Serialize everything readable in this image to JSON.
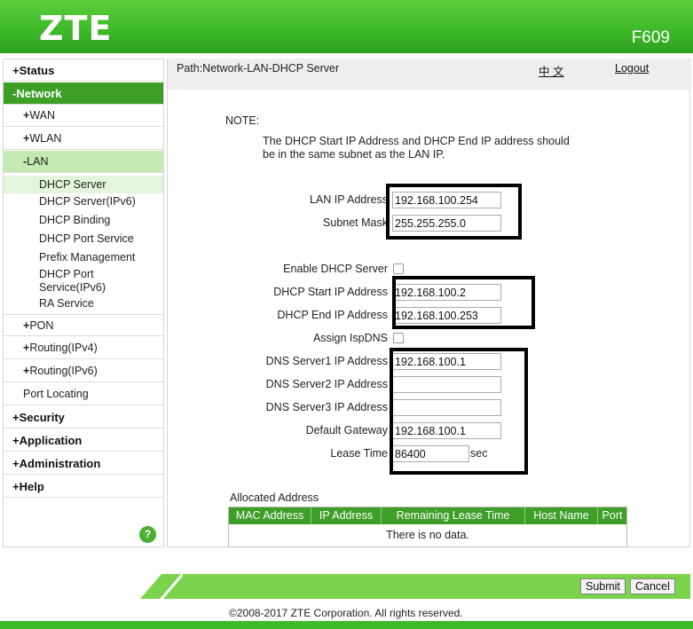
{
  "header": {
    "brand": "ZTE",
    "model": "F609"
  },
  "sidebar": {
    "top": [
      {
        "label": "Status",
        "marker": "+"
      },
      {
        "label": "Network",
        "marker": "-"
      }
    ],
    "network": [
      {
        "label": "WAN",
        "marker": "+"
      },
      {
        "label": "WLAN",
        "marker": "+"
      },
      {
        "label": "LAN",
        "marker": "-"
      }
    ],
    "lan_items": [
      "DHCP Server",
      "DHCP Server(IPv6)",
      "DHCP Binding",
      "DHCP Port Service",
      "Prefix Management",
      "DHCP Port",
      "Service(IPv6)",
      "RA Service"
    ],
    "network_after": [
      {
        "label": "PON",
        "marker": "+"
      },
      {
        "label": "Routing(IPv4)",
        "marker": "+"
      },
      {
        "label": "Routing(IPv6)",
        "marker": "+"
      },
      {
        "label": "Port Locating",
        "marker": ""
      }
    ],
    "bottom": [
      {
        "label": "Security",
        "marker": "+"
      },
      {
        "label": "Application",
        "marker": "+"
      },
      {
        "label": "Administration",
        "marker": "+"
      },
      {
        "label": "Help",
        "marker": "+"
      }
    ],
    "help_symbol": "?"
  },
  "pathbar": {
    "path": "Path:Network-LAN-DHCP Server",
    "language": "中 文",
    "logout": "Logout"
  },
  "note": {
    "label": "NOTE:",
    "line1": "The DHCP Start IP Address and DHCP End IP address should",
    "line2": "be in the same subnet as the LAN IP."
  },
  "form": {
    "lan_ip_label": "LAN IP Address",
    "lan_ip": "192.168.100.254",
    "subnet_label": "Subnet Mask",
    "subnet": "255.255.255.0",
    "enable_dhcp_label": "Enable DHCP Server",
    "start_ip_label": "DHCP Start IP Address",
    "start_ip": "192.168.100.2",
    "end_ip_label": "DHCP End IP Address",
    "end_ip": "192.168.100.253",
    "isp_dns_label": "Assign IspDNS",
    "dns1_label": "DNS Server1 IP Address",
    "dns1": "192.168.100.1",
    "dns2_label": "DNS Server2 IP Address",
    "dns2": "",
    "dns3_label": "DNS Server3 IP Address",
    "dns3": "",
    "gateway_label": "Default Gateway",
    "gateway": "192.168.100.1",
    "lease_label": "Lease Time",
    "lease": "86400",
    "lease_unit": "sec"
  },
  "allocated": {
    "title": "Allocated Address",
    "columns": [
      "MAC Address",
      "IP Address",
      "Remaining Lease Time",
      "Host Name",
      "Port"
    ],
    "empty_text": "There is no data."
  },
  "footer": {
    "submit": "Submit",
    "cancel": "Cancel",
    "copyright": "©2008-2017 ZTE Corporation. All rights reserved."
  },
  "colors": {
    "brand_green": "#3fb92a",
    "menu_active": "#3d9e28",
    "submenu_active": "#c5eab2"
  }
}
